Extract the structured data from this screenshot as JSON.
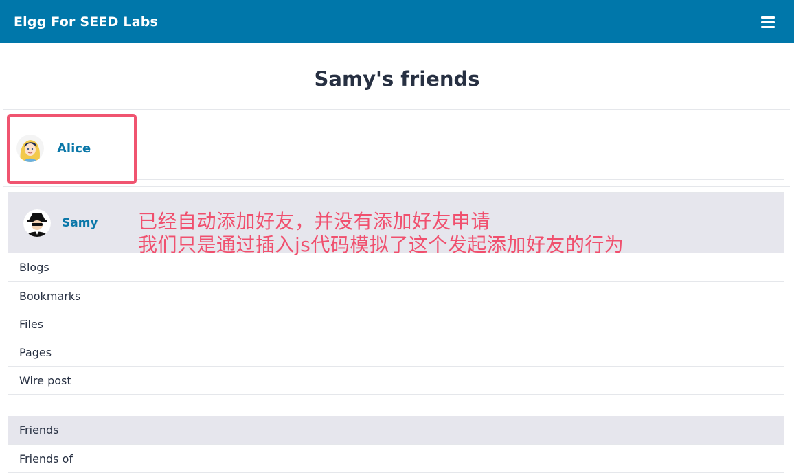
{
  "header": {
    "site_title": "Elgg For SEED Labs",
    "menu_icon": "hamburger-menu-icon",
    "background_color": "#0077aa"
  },
  "page": {
    "title": "Samy's friends"
  },
  "friends_list": [
    {
      "name": "Alice",
      "avatar_icon": "alice-avatar-icon"
    }
  ],
  "owner_block": {
    "name": "Samy",
    "avatar_icon": "samy-avatar-icon",
    "menu_items": [
      "Blogs",
      "Bookmarks",
      "Files",
      "Pages",
      "Wire post"
    ]
  },
  "friends_menu": {
    "items": [
      "Friends",
      "Friends of"
    ],
    "active": "Friends"
  },
  "annotation": {
    "line1": "已经自动添加好友，并没有添加好友申请",
    "line2": "我们只是通过插入js代码模拟了这个发起添加好友的行为",
    "color": "#f0506e"
  },
  "highlight_color": "#f05470"
}
